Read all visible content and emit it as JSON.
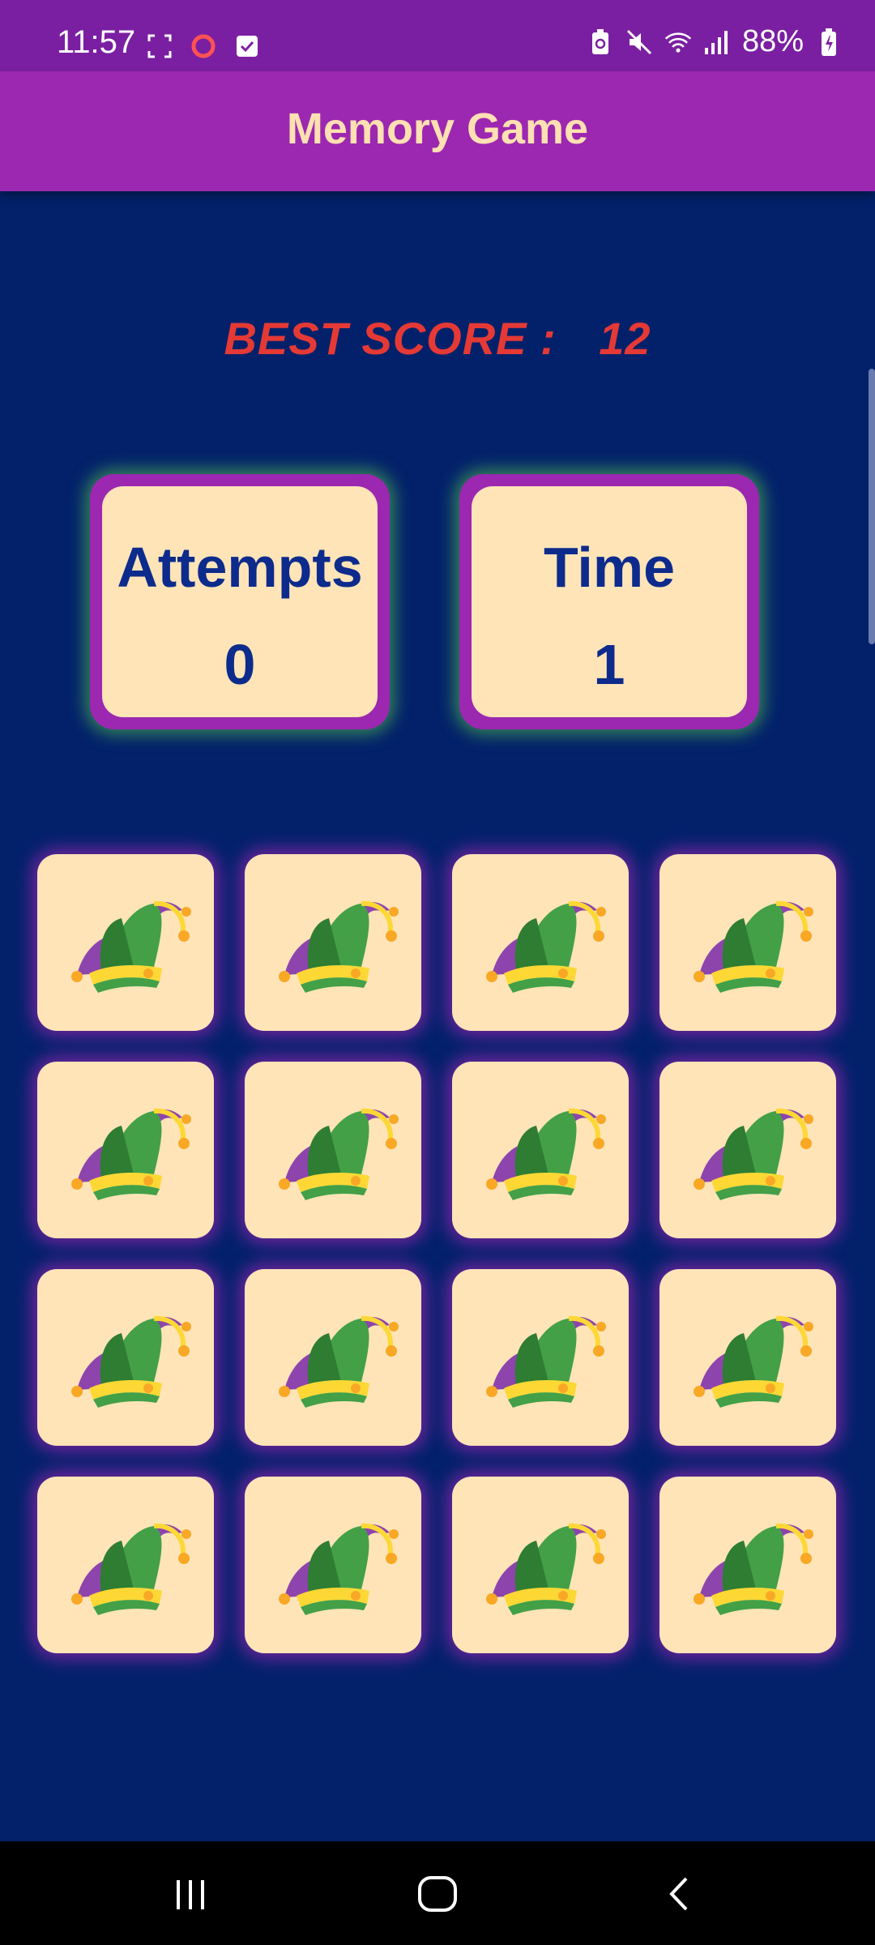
{
  "status_bar": {
    "time": "11:57",
    "battery": "88%",
    "icons_left": [
      "screenshot-icon",
      "record-icon",
      "check-icon"
    ],
    "icons_right": [
      "battery-saver-icon",
      "mute-icon",
      "wifi-icon",
      "signal-icon",
      "battery-icon"
    ]
  },
  "app_bar": {
    "title": "Memory Game"
  },
  "best_score": {
    "label": "BEST SCORE :",
    "value": "12"
  },
  "stats": {
    "attempts": {
      "label": "Attempts",
      "value": "0"
    },
    "time": {
      "label": "Time",
      "value": "1"
    }
  },
  "grid": {
    "rows": 4,
    "columns": 4,
    "tile_icon": "jester-hat-icon",
    "face_down": true
  },
  "colors": {
    "background": "#03216b",
    "app_bar": "#9c27b0",
    "status_bar": "#7b1fa2",
    "title_text": "#ffe0b2",
    "best_score": "#e53935",
    "card_face": "#ffe4b8",
    "stat_text": "#0d2b8c"
  },
  "nav_bar": {
    "buttons": [
      "recents-icon",
      "home-icon",
      "back-icon"
    ]
  }
}
